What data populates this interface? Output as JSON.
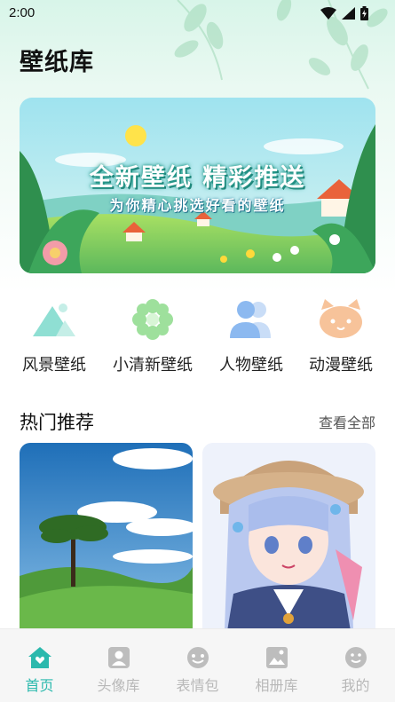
{
  "status_bar": {
    "time": "2:00"
  },
  "header": {
    "title": "壁纸库"
  },
  "banner": {
    "title": "全新壁纸 精彩推送",
    "subtitle": "为你精心挑选好看的壁纸"
  },
  "categories": [
    {
      "label": "风景壁纸",
      "icon": "mountain-icon"
    },
    {
      "label": "小清新壁纸",
      "icon": "flower-icon"
    },
    {
      "label": "人物壁纸",
      "icon": "people-icon"
    },
    {
      "label": "动漫壁纸",
      "icon": "cat-icon"
    }
  ],
  "section": {
    "title": "热门推荐",
    "see_all": "查看全部"
  },
  "bottom_nav": [
    {
      "label": "首页",
      "active": true,
      "icon": "home-icon"
    },
    {
      "label": "头像库",
      "icon": "avatar-icon"
    },
    {
      "label": "表情包",
      "icon": "emoji-pack-icon"
    },
    {
      "label": "相册库",
      "icon": "album-icon"
    },
    {
      "label": "我的",
      "icon": "smile-icon"
    }
  ],
  "colors": {
    "accent": "#2bb9ad",
    "nav_inactive": "#b8b8b8"
  }
}
